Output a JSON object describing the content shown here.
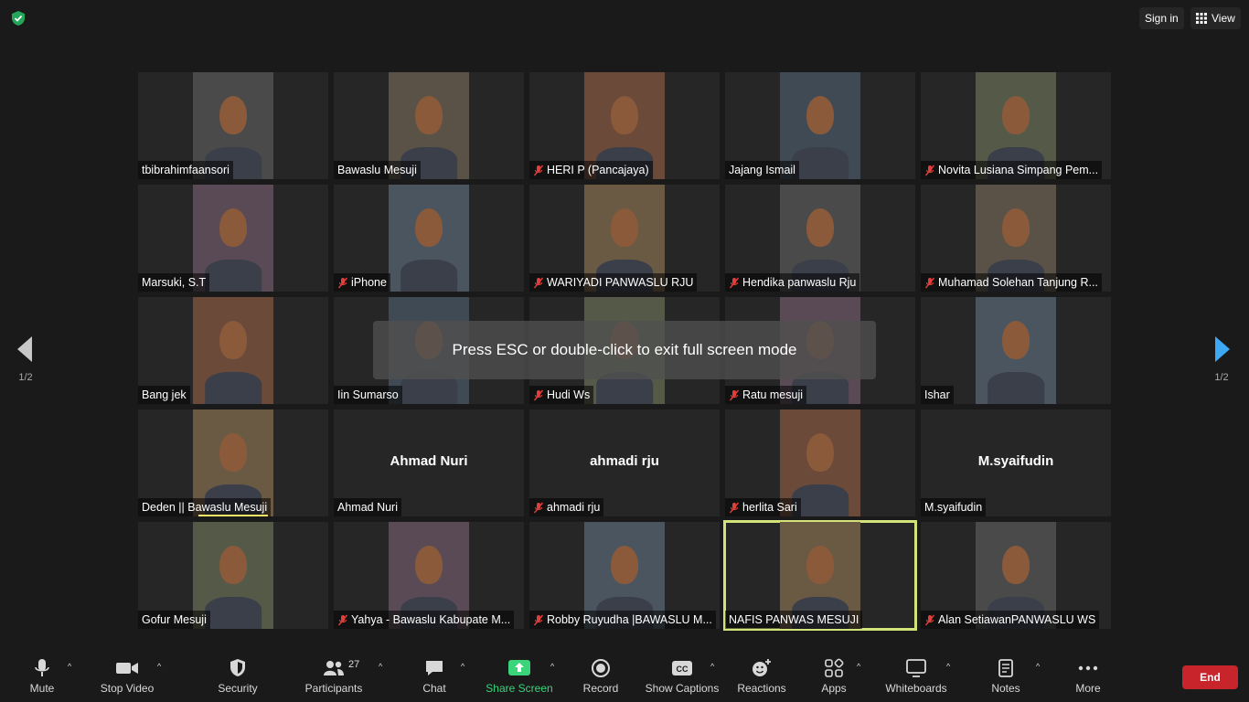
{
  "topbar": {
    "signin_label": "Sign in",
    "view_label": "View",
    "security_icon": "shield-check-icon"
  },
  "tiles": [
    {
      "name": "tbibrahimfaansori",
      "muted": false,
      "video": true
    },
    {
      "name": "Bawaslu Mesuji",
      "muted": false,
      "video": true
    },
    {
      "name": "HERI P (Pancajaya)",
      "muted": true,
      "video": true
    },
    {
      "name": "Jajang Ismail",
      "muted": false,
      "video": true
    },
    {
      "name": "Novita Lusiana Simpang Pem...",
      "muted": true,
      "video": true
    },
    {
      "name": "Marsuki, S.T",
      "muted": false,
      "video": true
    },
    {
      "name": "iPhone",
      "muted": true,
      "video": true
    },
    {
      "name": "WARIYADI PANWASLU RJU",
      "muted": true,
      "video": true
    },
    {
      "name": "Hendika panwaslu Rju",
      "muted": true,
      "video": true
    },
    {
      "name": "Muhamad Solehan Tanjung R...",
      "muted": true,
      "video": true
    },
    {
      "name": "Bang jek",
      "muted": false,
      "video": true
    },
    {
      "name": "Iin Sumarso",
      "muted": false,
      "video": true
    },
    {
      "name": "Hudi Ws",
      "muted": true,
      "video": true
    },
    {
      "name": "Ratu mesuji",
      "muted": true,
      "video": true
    },
    {
      "name": "Ishar",
      "muted": false,
      "video": true
    },
    {
      "name": "Deden || Bawaslu Mesuji",
      "muted": false,
      "video": true,
      "speaking": true
    },
    {
      "name": "Ahmad Nuri",
      "muted": false,
      "video": false,
      "big_name": "Ahmad Nuri"
    },
    {
      "name": "ahmadi rju",
      "muted": true,
      "video": false,
      "big_name": "ahmadi rju"
    },
    {
      "name": "herlita Sari",
      "muted": true,
      "video": true
    },
    {
      "name": "M.syaifudin",
      "muted": false,
      "video": false,
      "big_name": "M.syaifudin"
    },
    {
      "name": "Gofur Mesuji",
      "muted": false,
      "video": true
    },
    {
      "name": "Yahya - Bawaslu Kabupate M...",
      "muted": true,
      "video": true
    },
    {
      "name": "Robby Ruyudha |BAWASLU M...",
      "muted": true,
      "video": true
    },
    {
      "name": "NAFIS PANWAS MESUJI",
      "muted": false,
      "video": true,
      "active": true
    },
    {
      "name": "Alan SetiawanPANWASLU WS",
      "muted": true,
      "video": true
    }
  ],
  "toast": "Press ESC or double-click to exit full screen mode",
  "pager": {
    "left": "1/2",
    "right": "1/2"
  },
  "toolbar": {
    "mute": "Mute",
    "stop_video": "Stop Video",
    "security": "Security",
    "participants": "Participants",
    "participants_count": "27",
    "chat": "Chat",
    "share_screen": "Share Screen",
    "record": "Record",
    "show_captions": "Show Captions",
    "reactions": "Reactions",
    "apps": "Apps",
    "whiteboards": "Whiteboards",
    "notes": "Notes",
    "more": "More",
    "end": "End"
  },
  "colors": {
    "share_green": "#3ad47a",
    "end_red": "#c8242b",
    "active_border": "#d4e27a",
    "muted_red": "#e0403c"
  }
}
